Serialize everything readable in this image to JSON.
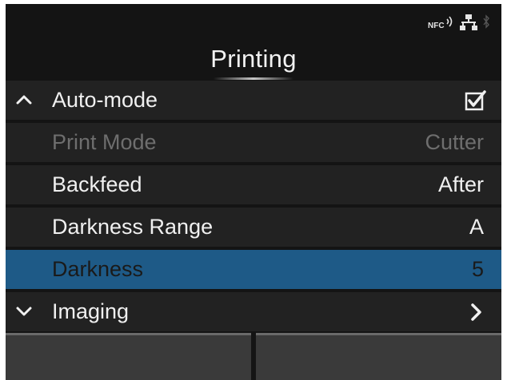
{
  "status": {
    "nfc_label": "NFC",
    "icons": [
      "nfc-icon",
      "network-icon",
      "bluetooth-icon"
    ]
  },
  "header": {
    "title": "Printing"
  },
  "menu": {
    "items": [
      {
        "label": "Auto-mode",
        "value": "",
        "state": "checked",
        "lead_icon": "chevron-up-icon",
        "trail_icon": "checkbox-checked-icon"
      },
      {
        "label": "Print Mode",
        "value": "Cutter",
        "state": "disabled"
      },
      {
        "label": "Backfeed",
        "value": "After"
      },
      {
        "label": "Darkness Range",
        "value": "A"
      },
      {
        "label": "Darkness",
        "value": "5",
        "state": "selected"
      },
      {
        "label": "Imaging",
        "value": "",
        "lead_icon": "chevron-down-icon",
        "trail_icon": "chevron-right-icon"
      }
    ]
  },
  "softkeys": [
    {
      "label": ""
    },
    {
      "label": ""
    }
  ],
  "colors": {
    "background": "#141414",
    "row": "#222222",
    "selected": "#1e5a87",
    "text": "#f0f0f0",
    "disabled_text": "#6e6e6e",
    "softkey": "#3a3a3a"
  }
}
